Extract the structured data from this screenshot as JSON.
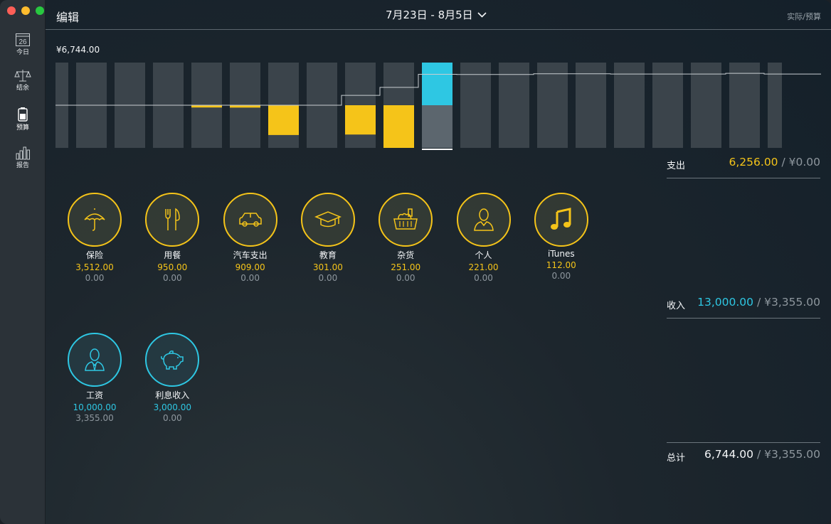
{
  "window": {
    "traffic_lights": [
      "close",
      "minimize",
      "zoom"
    ]
  },
  "sidebar": {
    "items": [
      {
        "label": "今日",
        "icon": "calendar-icon",
        "day": "26"
      },
      {
        "label": "结余",
        "icon": "balance-scale-icon"
      },
      {
        "label": "预算",
        "icon": "battery-icon"
      },
      {
        "label": "报告",
        "icon": "bar-chart-icon"
      }
    ]
  },
  "topbar": {
    "edit_label": "编辑",
    "date_range": "7月23日 - 8月5日",
    "view_toggle": "实际/预算"
  },
  "chart": {
    "max_label": "¥6,744.00"
  },
  "chart_data": {
    "type": "bar",
    "columns": 20,
    "highlight_index": 10,
    "expense_values": [
      0,
      0,
      0,
      0,
      95,
      100,
      1250,
      0,
      1230,
      1790,
      0,
      0,
      0,
      0,
      0,
      0,
      0,
      0,
      0,
      0
    ],
    "income_values": [
      0,
      0,
      0,
      0,
      0,
      0,
      0,
      0,
      0,
      0,
      1790,
      0,
      0,
      0,
      0,
      0,
      0,
      0,
      0,
      0
    ],
    "budget_value_highlight": 1790,
    "cumulative_line": [
      0,
      0,
      0,
      0,
      0,
      0,
      0,
      0,
      420,
      760,
      1320,
      1310,
      1310,
      1340,
      1340,
      1330,
      1330,
      1330,
      1360,
      1330
    ],
    "colors": {
      "expense": "#f5c419",
      "income": "#2ec7e3",
      "column": "#3b444b",
      "budget": "#5c666e",
      "line": "#c8cdd1"
    }
  },
  "expense_categories": [
    {
      "name": "保险",
      "icon": "umbrella-icon",
      "actual": "3,512.00",
      "budget": "0.00"
    },
    {
      "name": "用餐",
      "icon": "fork-knife-icon",
      "actual": "950.00",
      "budget": "0.00"
    },
    {
      "name": "汽车支出",
      "icon": "car-icon",
      "actual": "909.00",
      "budget": "0.00"
    },
    {
      "name": "教育",
      "icon": "graduation-cap-icon",
      "actual": "301.00",
      "budget": "0.00"
    },
    {
      "name": "杂货",
      "icon": "grocery-basket-icon",
      "actual": "251.00",
      "budget": "0.00"
    },
    {
      "name": "个人",
      "icon": "person-icon",
      "actual": "221.00",
      "budget": "0.00"
    },
    {
      "name": "iTunes",
      "icon": "music-note-icon",
      "actual": "112.00",
      "budget": "0.00"
    }
  ],
  "income_categories": [
    {
      "name": "工资",
      "icon": "employee-icon",
      "actual": "10,000.00",
      "budget": "3,355.00"
    },
    {
      "name": "利息收入",
      "icon": "piggy-bank-icon",
      "actual": "3,000.00",
      "budget": "0.00"
    }
  ],
  "summary": {
    "expense": {
      "label": "支出",
      "actual": "6,256.00",
      "budget": "¥0.00"
    },
    "income": {
      "label": "收入",
      "actual": "13,000.00",
      "budget": "¥3,355.00"
    },
    "total": {
      "label": "总计",
      "actual": "6,744.00",
      "budget": "¥3,355.00"
    },
    "separator": " / "
  },
  "colors": {
    "expense": "#f5c419",
    "income": "#2ec7e3"
  }
}
